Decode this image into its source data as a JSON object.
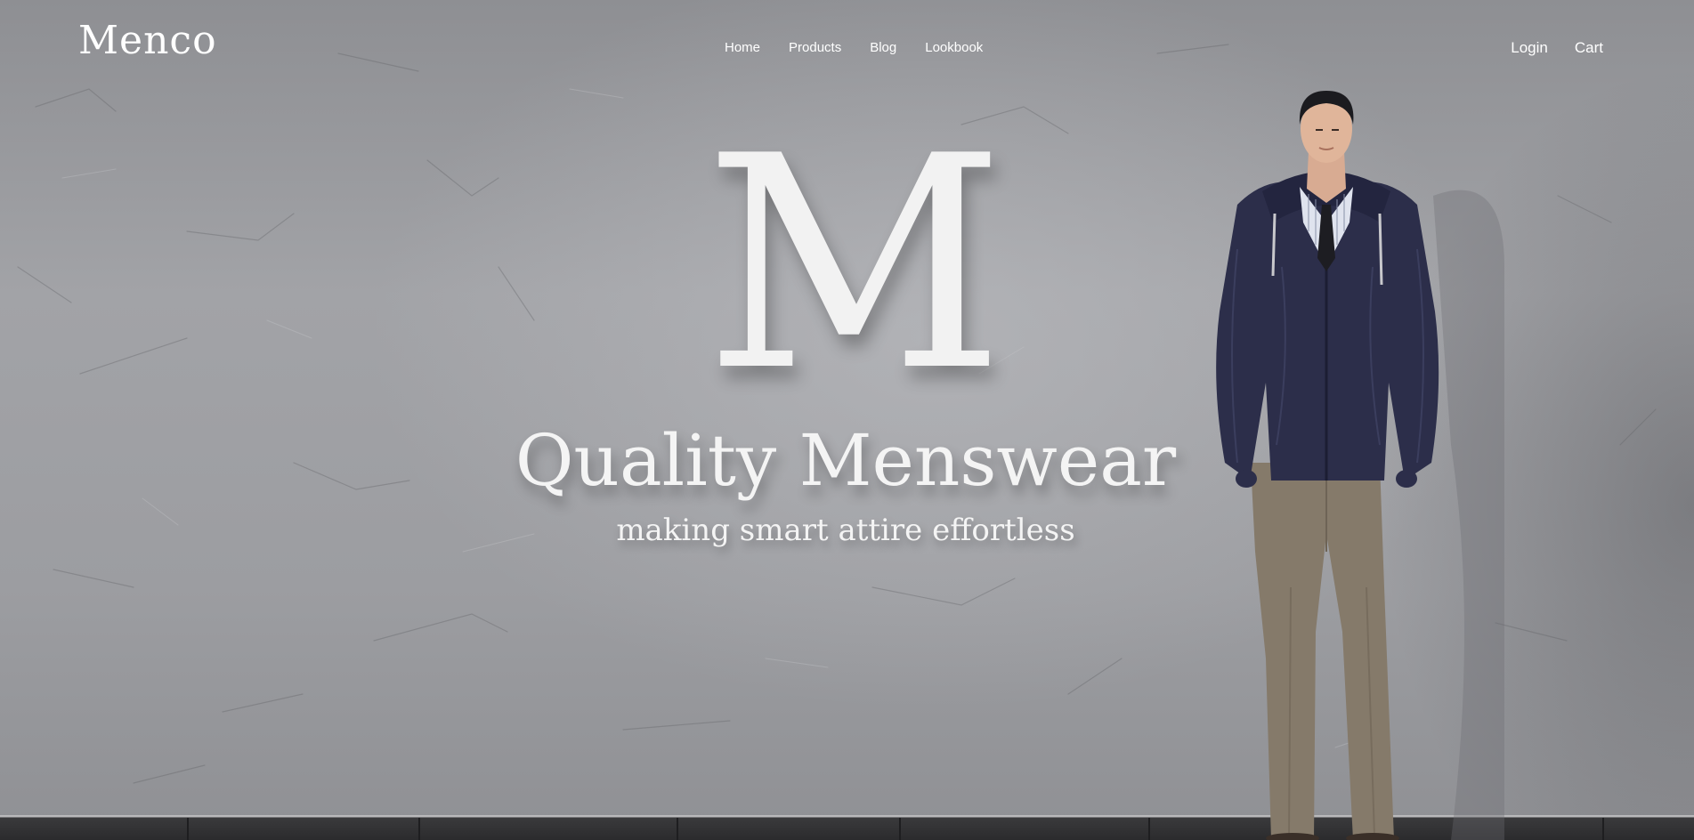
{
  "brand": {
    "logo_text": "Menco"
  },
  "nav": {
    "items": [
      {
        "label": "Home"
      },
      {
        "label": "Products"
      },
      {
        "label": "Blog"
      },
      {
        "label": "Lookbook"
      }
    ]
  },
  "account": {
    "login_label": "Login",
    "cart_label": "Cart"
  },
  "hero": {
    "monogram": "M",
    "title": "Quality Menswear",
    "subtitle": "making smart attire effortless",
    "image_subject": "male-model-navy-jacket"
  },
  "colors": {
    "wall": "#9c9da1",
    "text": "#f4f4f4",
    "jacket": "#2c2e4a",
    "trousers": "#857a6a"
  }
}
